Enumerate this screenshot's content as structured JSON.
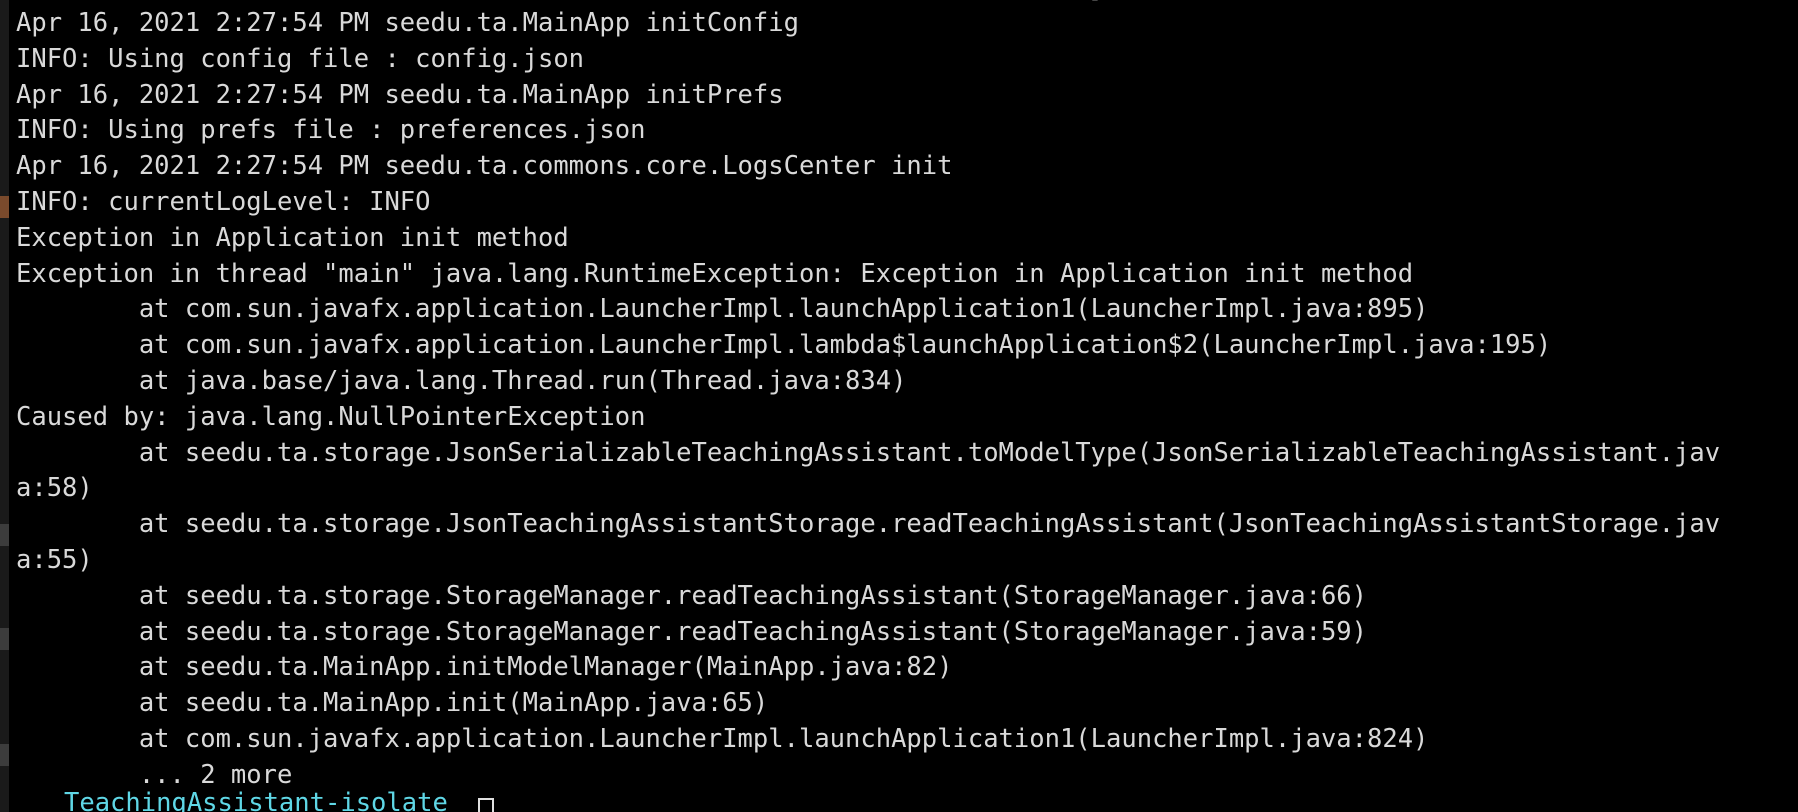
{
  "terminal": {
    "top_clipped_text": "]",
    "lines": [
      "Apr 16, 2021 2:27:54 PM seedu.ta.MainApp initConfig",
      "INFO: Using config file : config.json",
      "Apr 16, 2021 2:27:54 PM seedu.ta.MainApp initPrefs",
      "INFO: Using prefs file : preferences.json",
      "Apr 16, 2021 2:27:54 PM seedu.ta.commons.core.LogsCenter init",
      "INFO: currentLogLevel: INFO",
      "Exception in Application init method",
      "Exception in thread \"main\" java.lang.RuntimeException: Exception in Application init method",
      "        at com.sun.javafx.application.LauncherImpl.launchApplication1(LauncherImpl.java:895)",
      "        at com.sun.javafx.application.LauncherImpl.lambda$launchApplication$2(LauncherImpl.java:195)",
      "        at java.base/java.lang.Thread.run(Thread.java:834)",
      "Caused by: java.lang.NullPointerException",
      "        at seedu.ta.storage.JsonSerializableTeachingAssistant.toModelType(JsonSerializableTeachingAssistant.jav",
      "a:58)",
      "        at seedu.ta.storage.JsonTeachingAssistantStorage.readTeachingAssistant(JsonTeachingAssistantStorage.jav",
      "a:55)",
      "        at seedu.ta.storage.StorageManager.readTeachingAssistant(StorageManager.java:66)",
      "        at seedu.ta.storage.StorageManager.readTeachingAssistant(StorageManager.java:59)",
      "        at seedu.ta.MainApp.initModelManager(MainApp.java:82)",
      "        at seedu.ta.MainApp.init(MainApp.java:65)",
      "        at com.sun.javafx.application.LauncherImpl.launchApplication1(LauncherImpl.java:824)",
      "        ... 2 more"
    ],
    "prompt": "TeachingAssistant-isolate",
    "colors": {
      "background": "#000000",
      "text": "#d9d9d9",
      "prompt": "#5fd7e6",
      "cursor": "#e0e0e0"
    }
  }
}
